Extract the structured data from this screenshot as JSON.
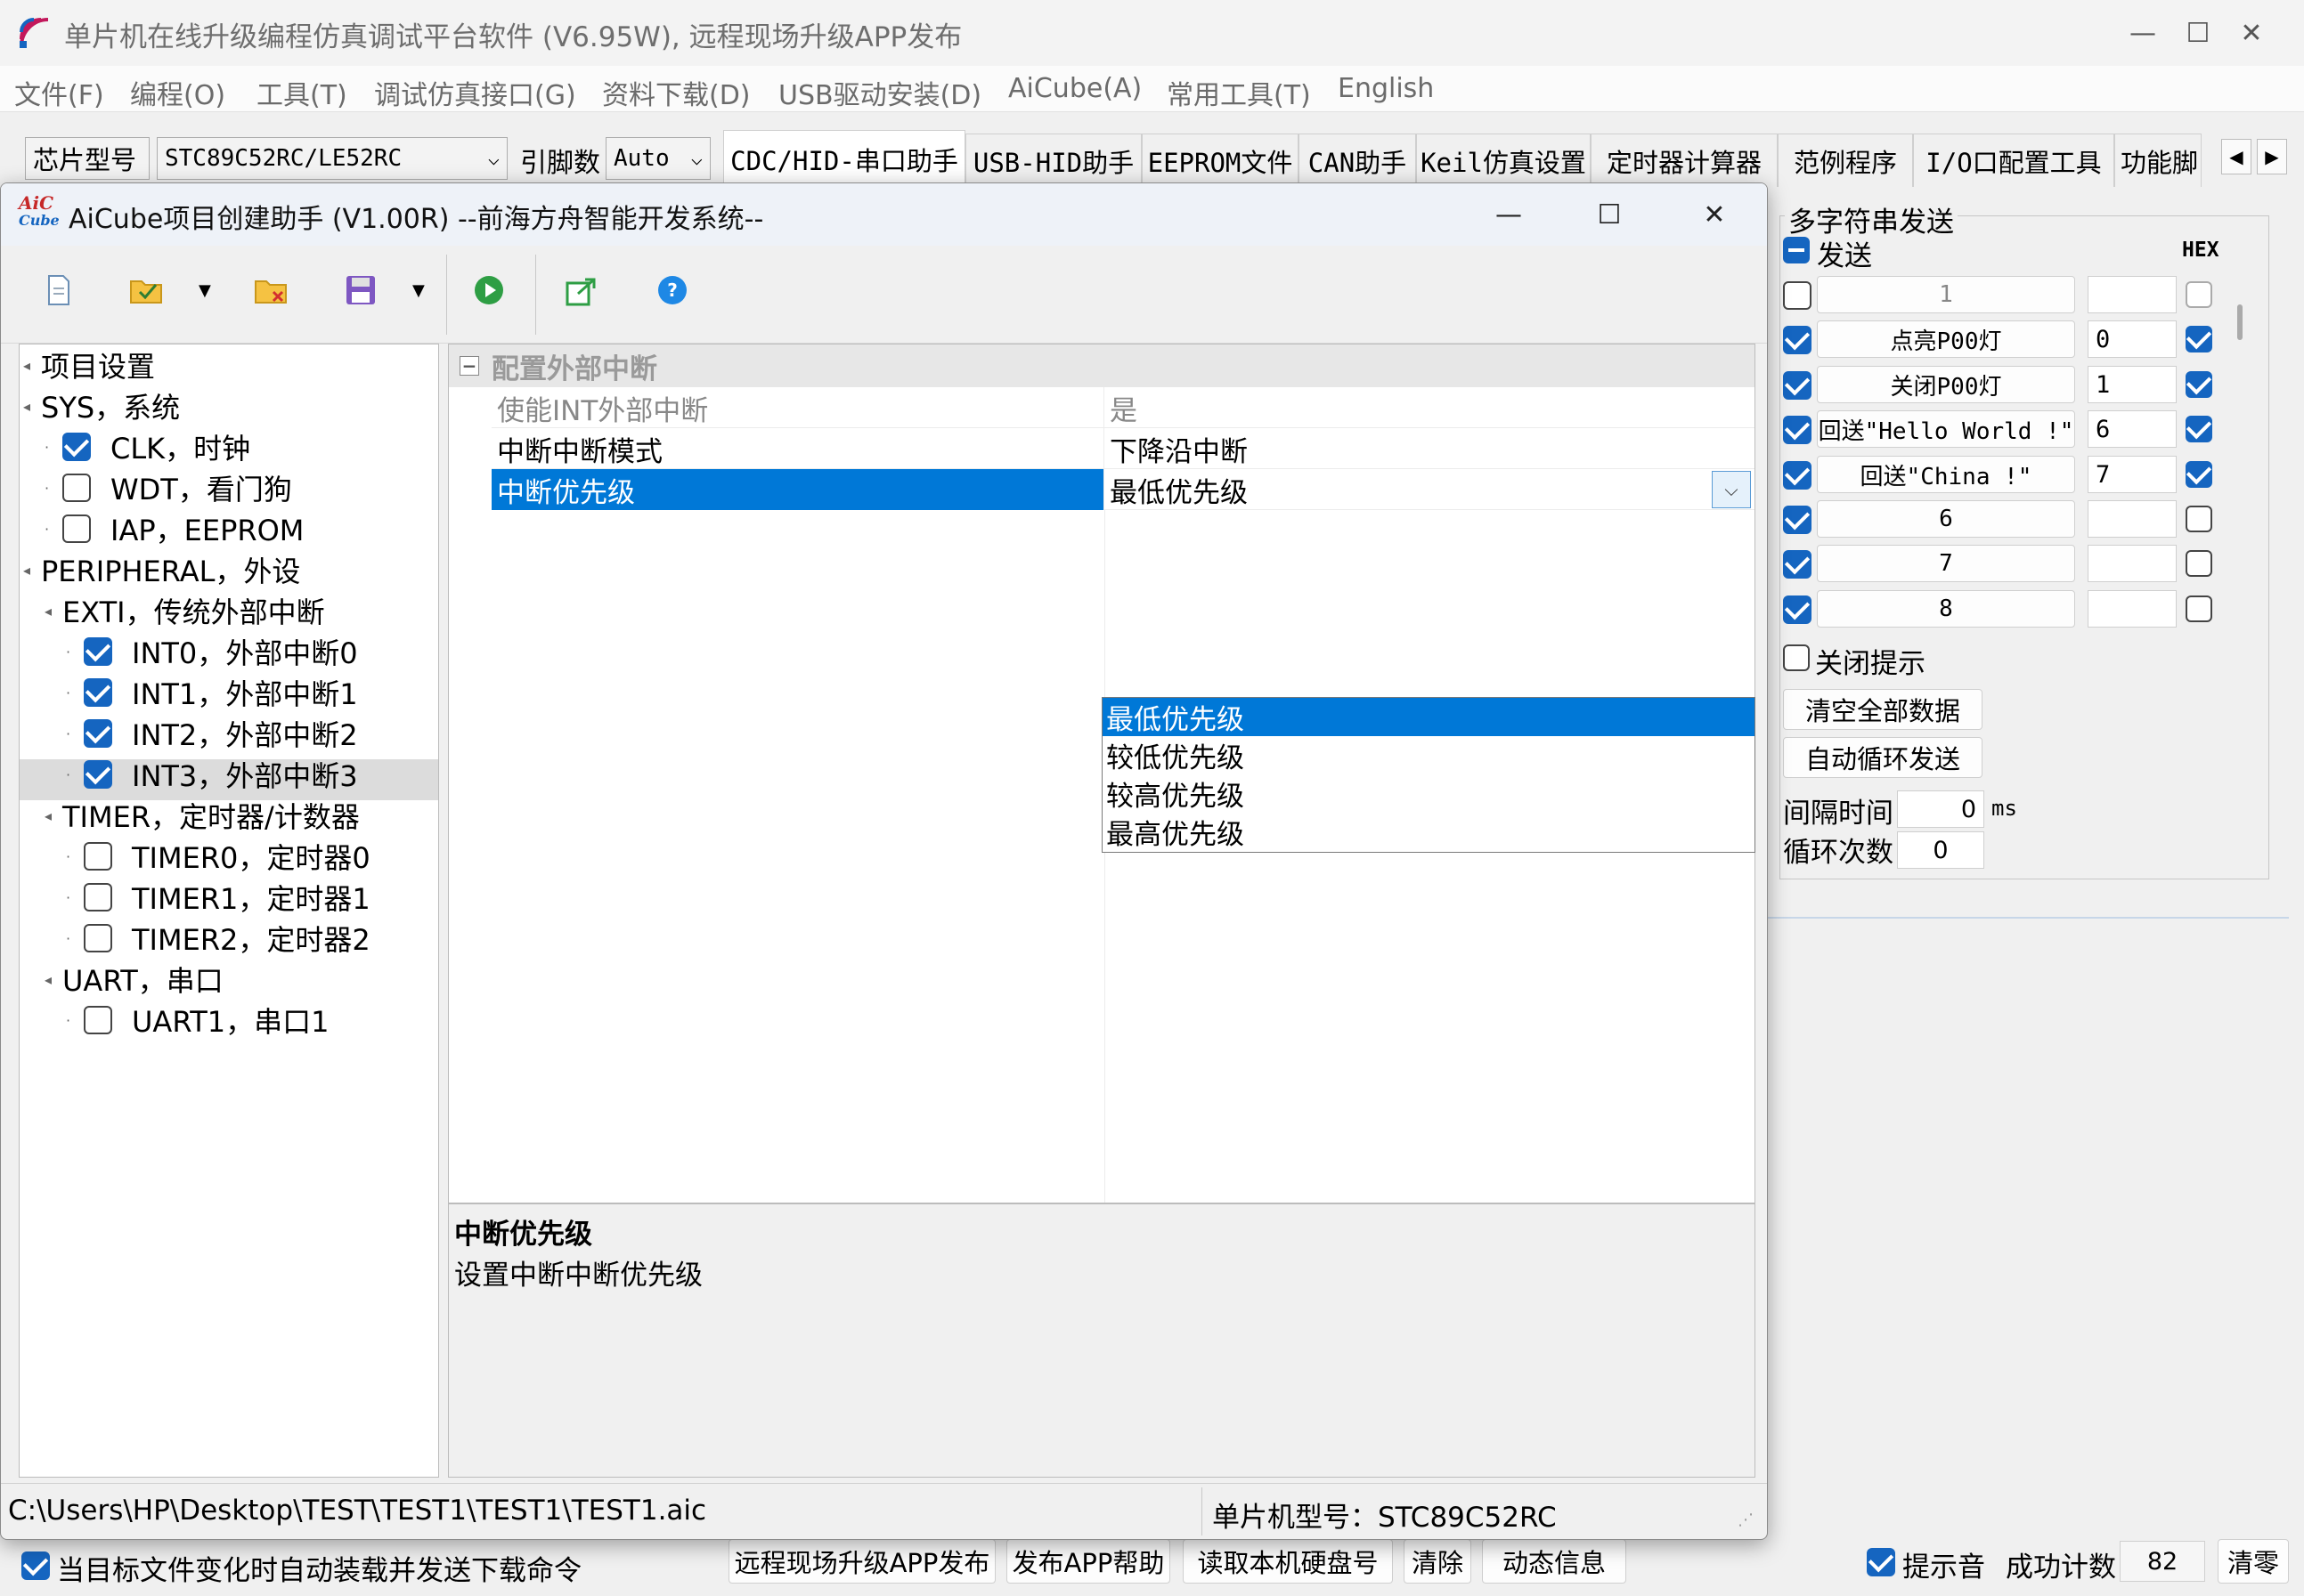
{
  "main": {
    "title": "单片机在线升级编程仿真调试平台软件 (V6.95W), 远程现场升级APP发布",
    "menu": [
      "文件(F)",
      "编程(O)",
      "工具(T)",
      "调试仿真接口(G)",
      "资料下载(D)",
      "USB驱动安装(D)",
      "AiCube(A)",
      "常用工具(T)",
      "English"
    ],
    "chip_label": "芯片型号",
    "chip_value": "STC89C52RC/LE52RC",
    "pins_label": "引脚数",
    "pins_value": "Auto",
    "tabs": [
      "CDC/HID-串口助手",
      "USB-HID助手",
      "EEPROM文件",
      "CAN助手",
      "Keil仿真设置",
      "定时器计算器",
      "范例程序",
      "I/O口配置工具",
      "功能脚"
    ]
  },
  "multi_send": {
    "title": "多字符串发送",
    "send_label": "发送",
    "hex_label": "HEX",
    "rows": [
      {
        "checked": false,
        "label": "1",
        "value": "",
        "hex": false
      },
      {
        "checked": true,
        "label": "点亮P00灯",
        "value": "0",
        "hex": true
      },
      {
        "checked": true,
        "label": "关闭P00灯",
        "value": "1",
        "hex": true
      },
      {
        "checked": true,
        "label": "回送\"Hello World !\"",
        "value": "6",
        "hex": true
      },
      {
        "checked": true,
        "label": "回送\"China !\"",
        "value": "7",
        "hex": true
      },
      {
        "checked": true,
        "label": "6",
        "value": "",
        "hex": false
      },
      {
        "checked": true,
        "label": "7",
        "value": "",
        "hex": false
      },
      {
        "checked": true,
        "label": "8",
        "value": "",
        "hex": false
      }
    ],
    "close_hint": "关闭提示",
    "clear_all": "清空全部数据",
    "auto_loop": "自动循环发送",
    "interval_label": "间隔时间",
    "interval_value": "0",
    "interval_unit": "ms",
    "loop_label": "循环次数",
    "loop_value": "0"
  },
  "bottom_bar": {
    "auto_load": "当目标文件变化时自动装载并发送下载命令",
    "buttons": [
      "远程现场升级APP发布",
      "发布APP帮助",
      "读取本机硬盘号",
      "清除",
      "动态信息"
    ],
    "beep": "提示音",
    "success_label": "成功计数",
    "success_value": "82",
    "reset": "清零"
  },
  "dialog": {
    "logo_top": "AiC",
    "logo_bottom": "Cube",
    "title": "AiCube项目创建助手 (V1.00R) --前海方舟智能开发系统--",
    "tree": [
      {
        "label": "项目设置",
        "level": 0,
        "checkbox": null
      },
      {
        "label": "SYS，系统",
        "level": 0,
        "checkbox": null
      },
      {
        "label": "CLK，时钟",
        "level": 1,
        "checkbox": true
      },
      {
        "label": "WDT，看门狗",
        "level": 1,
        "checkbox": false
      },
      {
        "label": "IAP，EEPROM",
        "level": 1,
        "checkbox": false
      },
      {
        "label": "PERIPHERAL，外设",
        "level": 0,
        "checkbox": null
      },
      {
        "label": "EXTI，传统外部中断",
        "level": 1,
        "checkbox": null
      },
      {
        "label": "INT0，外部中断0",
        "level": 2,
        "checkbox": true
      },
      {
        "label": "INT1，外部中断1",
        "level": 2,
        "checkbox": true
      },
      {
        "label": "INT2，外部中断2",
        "level": 2,
        "checkbox": true
      },
      {
        "label": "INT3，外部中断3",
        "level": 2,
        "checkbox": true
      },
      {
        "label": "TIMER，定时器/计数器",
        "level": 1,
        "checkbox": null
      },
      {
        "label": "TIMER0，定时器0",
        "level": 2,
        "checkbox": false
      },
      {
        "label": "TIMER1，定时器1",
        "level": 2,
        "checkbox": false
      },
      {
        "label": "TIMER2，定时器2",
        "level": 2,
        "checkbox": false
      },
      {
        "label": "UART，串口",
        "level": 1,
        "checkbox": null
      },
      {
        "label": "UART1，串口1",
        "level": 2,
        "checkbox": false
      }
    ],
    "group_title": "配置外部中断",
    "properties": [
      {
        "name": "使能INT外部中断",
        "value": "是"
      },
      {
        "name": "中断中断模式",
        "value": "下降沿中断"
      },
      {
        "name": "中断优先级",
        "value": "最低优先级"
      }
    ],
    "dropdown_options": [
      "最低优先级",
      "较低优先级",
      "较高优先级",
      "最高优先级"
    ],
    "desc_title": "中断优先级",
    "desc_text": "设置中断中断优先级",
    "path": "C:\\Users\\HP\\Desktop\\TEST\\TEST1\\TEST1\\TEST1.aic",
    "chip": "单片机型号：STC89C52RC"
  },
  "colors": {
    "selection": "#0078d7",
    "checkbox": "#1565c0"
  }
}
